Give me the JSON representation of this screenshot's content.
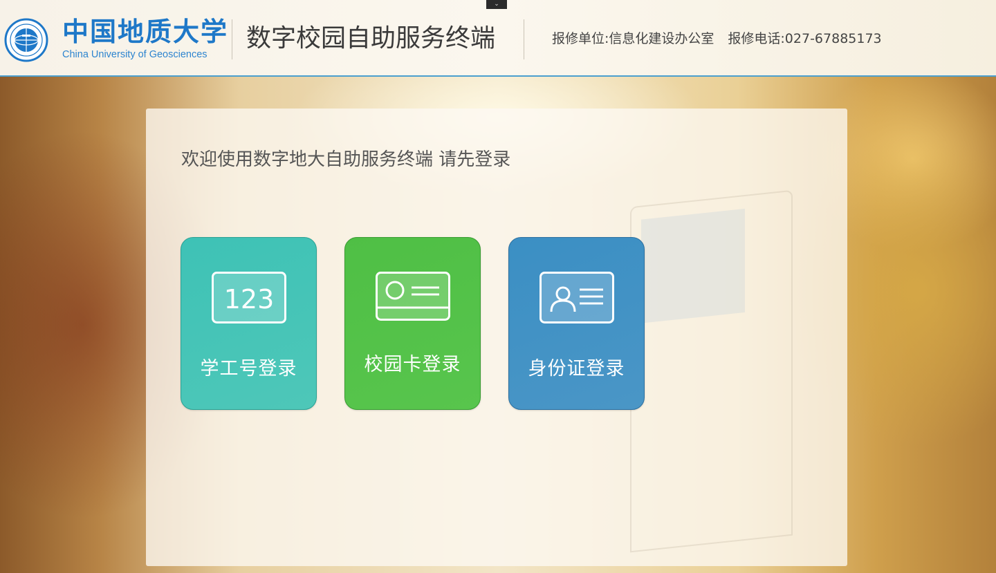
{
  "header": {
    "collapse_glyph": "⌄",
    "logo_cn": "中国地质大学",
    "logo_en": "China University of Geosciences",
    "system_title": "数字校园自助服务终端",
    "repair_unit": "报修单位:信息化建设办公室",
    "repair_phone": "报修电话:027-67885173"
  },
  "main": {
    "welcome": "欢迎使用数字地大自助服务终端 请先登录",
    "tiles": [
      {
        "label": "学工号登录",
        "icon": "number-123-icon",
        "icon_text": "123",
        "color": "#46c4b7"
      },
      {
        "label": "校园卡登录",
        "icon": "campus-card-icon",
        "color": "#52c148"
      },
      {
        "label": "身份证登录",
        "icon": "id-card-icon",
        "color": "#4391c4"
      }
    ]
  },
  "colors": {
    "brand_blue": "#1e78c8",
    "header_border": "#4a9fcf"
  }
}
